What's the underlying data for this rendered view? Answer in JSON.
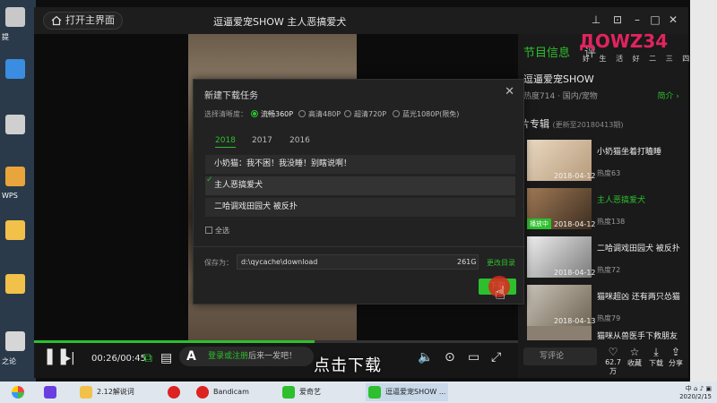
{
  "window": {
    "home_button": "打开主界面",
    "title": "逗逼爱宠SHOW 主人恶搞爱犬"
  },
  "logo": {
    "text": "ДOWZ34",
    "sub": "好 生 活 好 二 三 四"
  },
  "player": {
    "time": "00:26/00:45",
    "progress": 0.58,
    "login_prefix": "登录或注册",
    "login_suffix": "后来一发吧！",
    "subtitle": "点击下载"
  },
  "sidebar": {
    "tabs": [
      "节目信息",
      "评"
    ],
    "show_name": "逗逼爱宠SHOW",
    "heat": "热度714 · 国内/宠物",
    "intro": "简介 ›",
    "album_title": "片专辑",
    "album_note": "(更新至20180413期)",
    "episodes": [
      {
        "title": "小奶猫坐着打瞌睡",
        "date": "2018-04-12",
        "heat": "热度63",
        "active": false,
        "badge": ""
      },
      {
        "title": "主人恶搞爱犬",
        "date": "2018-04-12",
        "heat": "热度138",
        "active": true,
        "badge": "播放中"
      },
      {
        "title": "二哈调戏田园犬 被反扑",
        "date": "2018-04-12",
        "heat": "热度72",
        "active": false,
        "badge": ""
      },
      {
        "title": "猫咪超凶 还有两只怂猫",
        "date": "2018-04-13",
        "heat": "热度79",
        "active": false,
        "badge": ""
      },
      {
        "title": "猫咪从兽医手下救朋友",
        "date": "",
        "heat": "",
        "active": false,
        "badge": ""
      }
    ],
    "comment_placeholder": "写评论",
    "actions": [
      {
        "icon": "heart-icon",
        "glyph": "♡",
        "label": "62.7万"
      },
      {
        "icon": "star-icon",
        "glyph": "☆",
        "label": "收藏"
      },
      {
        "icon": "download-icon",
        "glyph": "⤓",
        "label": "下载"
      },
      {
        "icon": "share-icon",
        "glyph": "⇪",
        "label": "分享"
      }
    ]
  },
  "modal": {
    "title": "新建下载任务",
    "quality_label": "选择清晰度：",
    "qualities": [
      {
        "label": "流畅360P",
        "selected": true
      },
      {
        "label": "高清480P",
        "selected": false
      },
      {
        "label": "超清720P",
        "selected": false
      },
      {
        "label": "蓝光1080P(限免)",
        "selected": false
      }
    ],
    "years": [
      "2018",
      "2017",
      "2016"
    ],
    "items": [
      {
        "label": "小奶猫：我不困！我没睡！别瞎说啊！",
        "checked": false
      },
      {
        "label": "主人恶搞爱犬",
        "checked": true
      },
      {
        "label": "二哈调戏田园犬 被反扑",
        "checked": false
      }
    ],
    "select_all": "全选",
    "save_label": "保存为：",
    "save_path": "d:\\qycache\\download",
    "save_size": "261G",
    "change_dir": "更改目录",
    "download_button": "下载"
  },
  "taskbar": {
    "items": [
      "2.12解说词",
      "",
      "Bandicam",
      "爱奇艺",
      "逗逼爱宠SHOW ..."
    ],
    "tray_time": "2020/2/15"
  },
  "desktop_labels": [
    "提",
    "WPS",
    "之论"
  ]
}
